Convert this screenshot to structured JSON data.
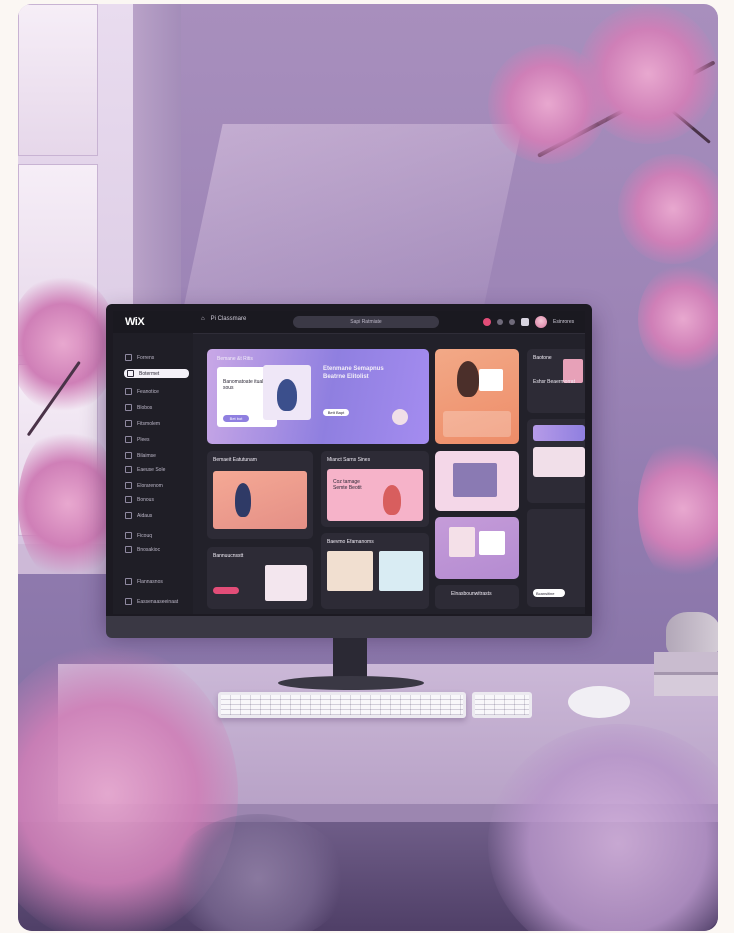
{
  "scene": {
    "description_colors": {
      "wall": "#9c84b6",
      "blossom": "#d98bc1",
      "desk": "#cbb8d7"
    }
  },
  "screen": {
    "logo": "WiX",
    "workspace": "Pi Classmare",
    "search_placeholder": "Sapi Ratmiate",
    "user_name": "Esinrores",
    "sidebar": {
      "items": [
        {
          "label": "Forrens",
          "icon": "home-icon"
        },
        {
          "label": "Botermet",
          "icon": "file-icon"
        },
        {
          "label": "Feanotice",
          "icon": "grid-icon"
        },
        {
          "label": "Blobos",
          "icon": "grid-icon"
        },
        {
          "label": "Fitsmolem",
          "icon": "grid-icon"
        },
        {
          "label": "Plees",
          "icon": "grid-icon"
        },
        {
          "label": "Bilaimse",
          "icon": "grid-icon"
        },
        {
          "label": "Eaeuse Sole",
          "icon": "grid-icon"
        },
        {
          "label": "Elorarenom",
          "icon": "grid-icon"
        },
        {
          "label": "Bonous",
          "icon": "grid-icon"
        },
        {
          "label": "Aidaus",
          "icon": "grid-icon"
        },
        {
          "label": "Ficouq",
          "icon": "grid-icon"
        },
        {
          "label": "Bnosakioc",
          "icon": "grid-icon"
        },
        {
          "label": "Flannasnos",
          "icon": "grid-icon"
        },
        {
          "label": "Eassenaaseeinaat",
          "icon": "settings-icon"
        }
      ]
    },
    "hero": {
      "label": "Bemane &t Ritis",
      "title": "Etenmane Semapnus Beatrne Elitolist",
      "card_title": "Banomatoate ituab sous",
      "button": "Bett Bapt",
      "button2": "Bet bot"
    },
    "panels": {
      "featured": "Bemaeit Eatutunam",
      "cards_title": "Mianct Sarns Sines",
      "cards_body": "Coz tamage Semte Beotit",
      "promo": "Bannuucnsstt",
      "tiles_title": "Baevmo Efarnanoms",
      "bottom_title": "Elnasbounwitrasts",
      "right_top": "Baotone",
      "right_text": "Eshsr Beaermorrat",
      "right_button": "Bcansitine"
    }
  }
}
